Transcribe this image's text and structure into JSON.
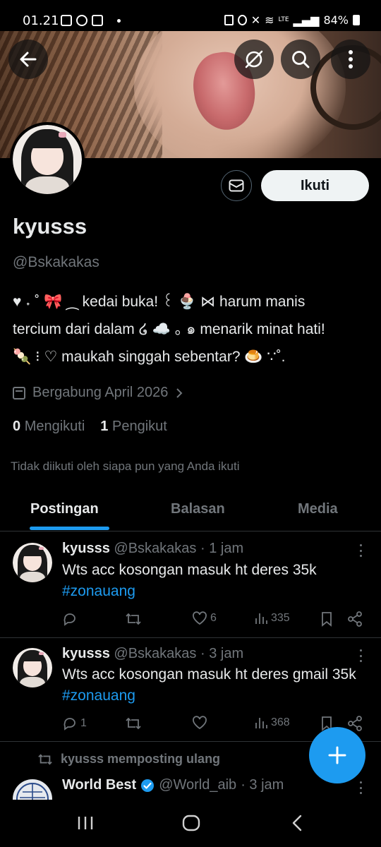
{
  "status_bar": {
    "time": "01.21",
    "battery": "84%",
    "network": "LTE"
  },
  "header": {
    "back_icon": "arrow-left-icon",
    "icons": [
      "hide-eye-icon",
      "search-icon",
      "more-vertical-icon"
    ]
  },
  "profile": {
    "name": "kyusss",
    "handle": "@Bskakakas",
    "bio_lines": [
      "♥ ˖ ˚ 🎀 ⁔ kedai buka! ꒰ 🍨 ⋈ harum manis",
      "tercium dari dalam ໒ ☁️ ｡ ๑ menarik minat hati!",
      "🍡 ⁝ ♡ maukah singgah sebentar? 🍮 ∵˚."
    ],
    "joined": "Bergabung April 2026",
    "following_count": "0",
    "following_label": "Mengikuti",
    "followers_count": "1",
    "followers_label": "Pengikut",
    "not_followed_text": "Tidak diikuti oleh siapa pun yang Anda ikuti",
    "follow_button": "Ikuti"
  },
  "tabs": [
    {
      "label": "Postingan",
      "active": true
    },
    {
      "label": "Balasan",
      "active": false
    },
    {
      "label": "Media",
      "active": false
    }
  ],
  "posts": [
    {
      "name": "kyusss",
      "handle": "@Bskakakas",
      "time": "· 1 jam",
      "text": "Wts acc kosongan masuk ht deres 35k",
      "hashtag": "#zonauang",
      "replies": "",
      "reposts": "",
      "likes": "6",
      "views": "335"
    },
    {
      "name": "kyusss",
      "handle": "@Bskakakas",
      "time": "· 3 jam",
      "text": "Wts acc kosongan masuk ht deres gmail 35k",
      "hashtag": "#zonauang",
      "replies": "1",
      "reposts": "",
      "likes": "",
      "views": "368"
    }
  ],
  "repost": {
    "label": "kyusss memposting ulang",
    "name": "World Best",
    "handle": "@World_aib",
    "time": "· 3 jam"
  },
  "colors": {
    "accent": "#1d9bf0",
    "secondary_text": "#71767b",
    "divider": "#2f3336"
  }
}
